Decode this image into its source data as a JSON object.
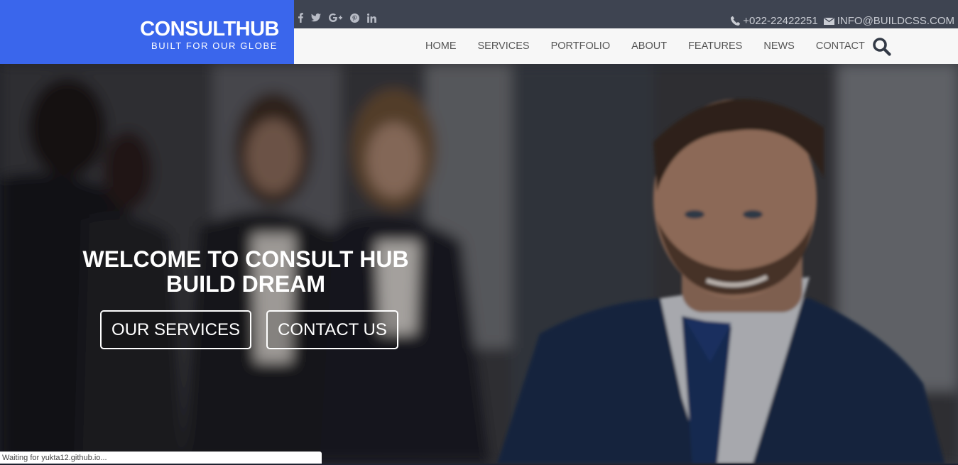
{
  "brand": {
    "title": "CONSULTHUB",
    "tagline": "BUILT FOR OUR GLOBE",
    "color": "#3a66ec"
  },
  "topbar": {
    "social_icons": [
      "facebook-icon",
      "twitter-icon",
      "google-plus-icon",
      "pinterest-icon",
      "linkedin-icon"
    ],
    "phone": "+022-22422251",
    "email": "INFO@BUILDCSS.COM"
  },
  "nav": {
    "items": [
      {
        "label": "HOME"
      },
      {
        "label": "SERVICES"
      },
      {
        "label": "PORTFOLIO"
      },
      {
        "label": "ABOUT"
      },
      {
        "label": "FEATURES"
      },
      {
        "label": "NEWS"
      },
      {
        "label": "CONTACT"
      }
    ],
    "search_icon": "search-icon"
  },
  "hero": {
    "title_line1": "WELCOME TO CONSULT HUB",
    "title_line2": "BUILD DREAM",
    "button_services": "OUR SERVICES",
    "button_contact": "CONTACT US"
  },
  "status": {
    "text": "Waiting for yukta12.github.io..."
  }
}
